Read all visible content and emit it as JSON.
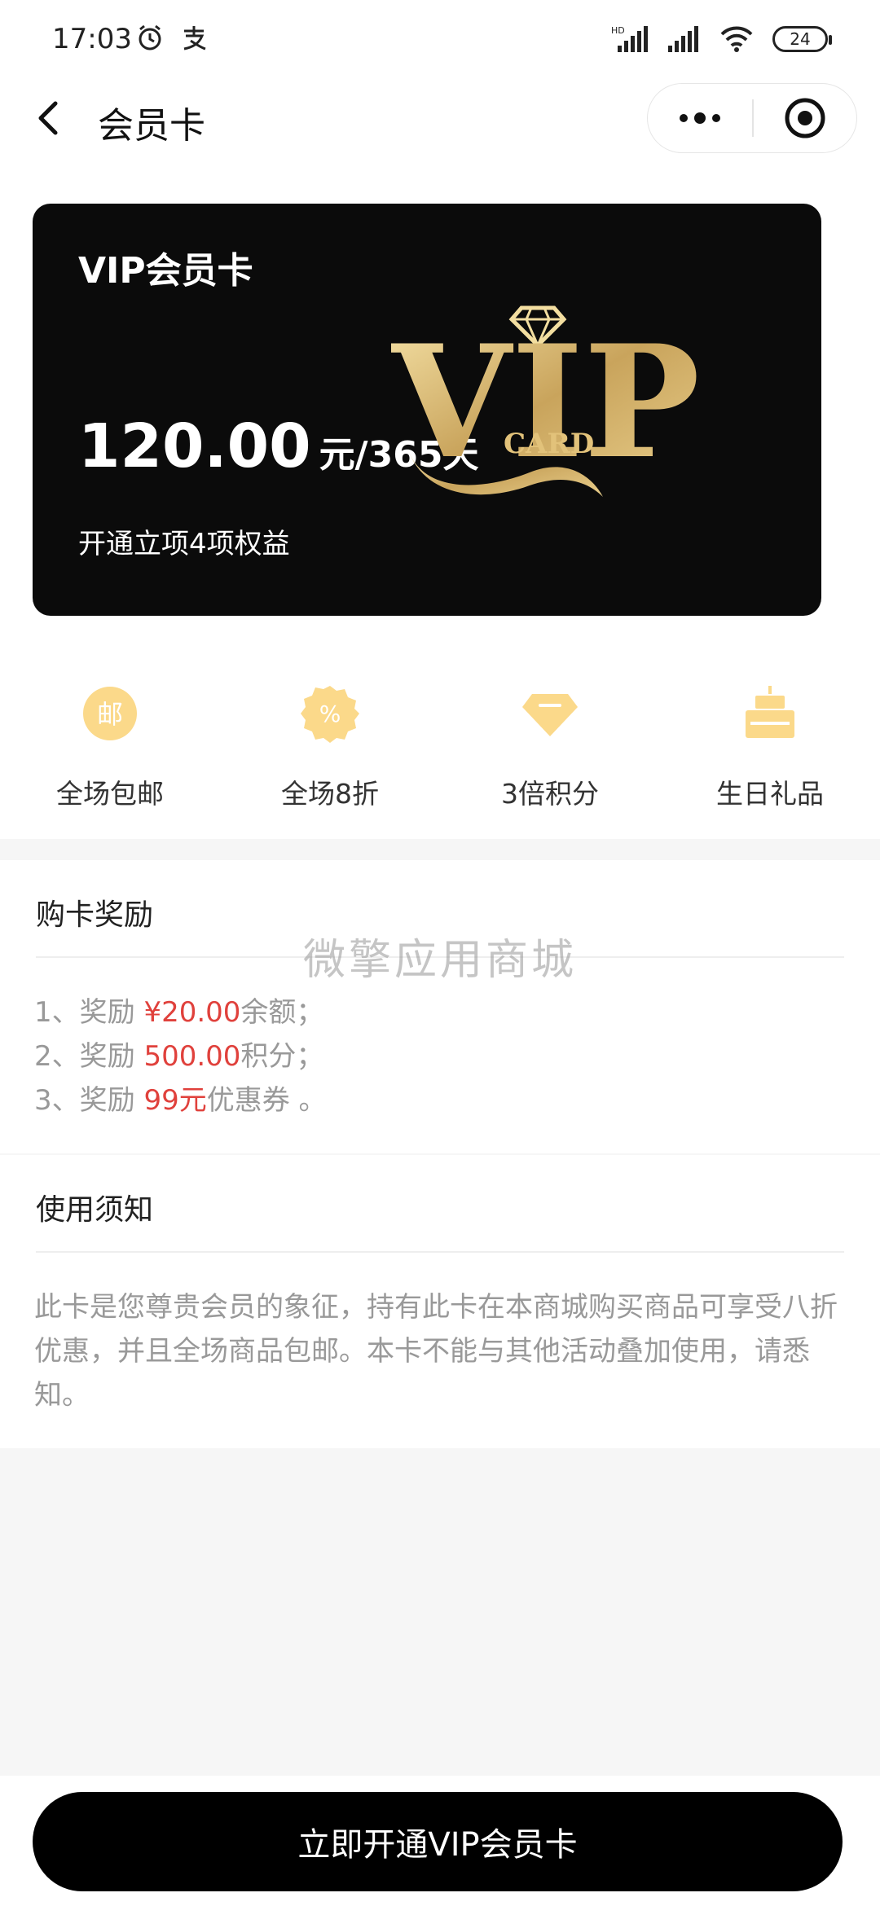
{
  "status_bar": {
    "time": "17:03",
    "battery": "24",
    "icons": [
      "alarm-icon",
      "alipay-icon",
      "hd-signal-icon",
      "signal-icon",
      "wifi-icon",
      "battery-icon"
    ]
  },
  "nav": {
    "title": "会员卡",
    "back_icon": "chevron-left-icon",
    "more_icon": "more-dots-icon",
    "target_icon": "target-icon"
  },
  "card": {
    "title": "VIP会员卡",
    "price": "120.00",
    "unit": "元/365天",
    "benefit_note": "开通立项4项权益",
    "logo_text": "VIP",
    "logo_sub": "CARD"
  },
  "benefits": [
    {
      "label": "全场包邮",
      "icon": "mail-badge-icon",
      "glyph": "邮"
    },
    {
      "label": "全场8折",
      "icon": "percent-badge-icon",
      "glyph": "%"
    },
    {
      "label": "3倍积分",
      "icon": "diamond-icon"
    },
    {
      "label": "生日礼品",
      "icon": "cake-icon"
    }
  ],
  "reward": {
    "title": "购卡奖励",
    "items": [
      {
        "prefix": "1、奖励 ",
        "value": "¥20.00",
        "suffix": "余额；"
      },
      {
        "prefix": "2、奖励 ",
        "value": "500.00",
        "suffix": "积分；"
      },
      {
        "prefix": "3、奖励 ",
        "value": "99元",
        "suffix": "优惠券 。"
      }
    ]
  },
  "watermark": "微擎应用商城",
  "notice": {
    "title": "使用须知",
    "text": "此卡是您尊贵会员的象征，持有此卡在本商城购买商品可享受八折优惠，并且全场商品包邮。本卡不能与其他活动叠加使用，请悉知。"
  },
  "cta": {
    "label": "立即开通VIP会员卡"
  },
  "colors": {
    "gold": "#fbd98a",
    "red": "#e0413c",
    "card_bg": "#0b0b0b"
  }
}
